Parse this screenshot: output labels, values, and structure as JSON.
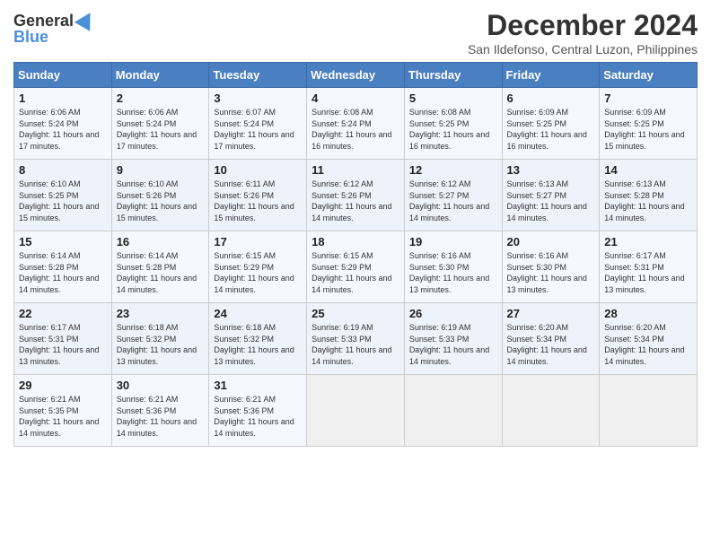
{
  "header": {
    "logo_line1": "General",
    "logo_line2": "Blue",
    "title": "December 2024",
    "subtitle": "San Ildefonso, Central Luzon, Philippines"
  },
  "days_of_week": [
    "Sunday",
    "Monday",
    "Tuesday",
    "Wednesday",
    "Thursday",
    "Friday",
    "Saturday"
  ],
  "weeks": [
    [
      {
        "day": "1",
        "sunrise": "Sunrise: 6:06 AM",
        "sunset": "Sunset: 5:24 PM",
        "daylight": "Daylight: 11 hours and 17 minutes."
      },
      {
        "day": "2",
        "sunrise": "Sunrise: 6:06 AM",
        "sunset": "Sunset: 5:24 PM",
        "daylight": "Daylight: 11 hours and 17 minutes."
      },
      {
        "day": "3",
        "sunrise": "Sunrise: 6:07 AM",
        "sunset": "Sunset: 5:24 PM",
        "daylight": "Daylight: 11 hours and 17 minutes."
      },
      {
        "day": "4",
        "sunrise": "Sunrise: 6:08 AM",
        "sunset": "Sunset: 5:24 PM",
        "daylight": "Daylight: 11 hours and 16 minutes."
      },
      {
        "day": "5",
        "sunrise": "Sunrise: 6:08 AM",
        "sunset": "Sunset: 5:25 PM",
        "daylight": "Daylight: 11 hours and 16 minutes."
      },
      {
        "day": "6",
        "sunrise": "Sunrise: 6:09 AM",
        "sunset": "Sunset: 5:25 PM",
        "daylight": "Daylight: 11 hours and 16 minutes."
      },
      {
        "day": "7",
        "sunrise": "Sunrise: 6:09 AM",
        "sunset": "Sunset: 5:25 PM",
        "daylight": "Daylight: 11 hours and 15 minutes."
      }
    ],
    [
      {
        "day": "8",
        "sunrise": "Sunrise: 6:10 AM",
        "sunset": "Sunset: 5:25 PM",
        "daylight": "Daylight: 11 hours and 15 minutes."
      },
      {
        "day": "9",
        "sunrise": "Sunrise: 6:10 AM",
        "sunset": "Sunset: 5:26 PM",
        "daylight": "Daylight: 11 hours and 15 minutes."
      },
      {
        "day": "10",
        "sunrise": "Sunrise: 6:11 AM",
        "sunset": "Sunset: 5:26 PM",
        "daylight": "Daylight: 11 hours and 15 minutes."
      },
      {
        "day": "11",
        "sunrise": "Sunrise: 6:12 AM",
        "sunset": "Sunset: 5:26 PM",
        "daylight": "Daylight: 11 hours and 14 minutes."
      },
      {
        "day": "12",
        "sunrise": "Sunrise: 6:12 AM",
        "sunset": "Sunset: 5:27 PM",
        "daylight": "Daylight: 11 hours and 14 minutes."
      },
      {
        "day": "13",
        "sunrise": "Sunrise: 6:13 AM",
        "sunset": "Sunset: 5:27 PM",
        "daylight": "Daylight: 11 hours and 14 minutes."
      },
      {
        "day": "14",
        "sunrise": "Sunrise: 6:13 AM",
        "sunset": "Sunset: 5:28 PM",
        "daylight": "Daylight: 11 hours and 14 minutes."
      }
    ],
    [
      {
        "day": "15",
        "sunrise": "Sunrise: 6:14 AM",
        "sunset": "Sunset: 5:28 PM",
        "daylight": "Daylight: 11 hours and 14 minutes."
      },
      {
        "day": "16",
        "sunrise": "Sunrise: 6:14 AM",
        "sunset": "Sunset: 5:28 PM",
        "daylight": "Daylight: 11 hours and 14 minutes."
      },
      {
        "day": "17",
        "sunrise": "Sunrise: 6:15 AM",
        "sunset": "Sunset: 5:29 PM",
        "daylight": "Daylight: 11 hours and 14 minutes."
      },
      {
        "day": "18",
        "sunrise": "Sunrise: 6:15 AM",
        "sunset": "Sunset: 5:29 PM",
        "daylight": "Daylight: 11 hours and 14 minutes."
      },
      {
        "day": "19",
        "sunrise": "Sunrise: 6:16 AM",
        "sunset": "Sunset: 5:30 PM",
        "daylight": "Daylight: 11 hours and 13 minutes."
      },
      {
        "day": "20",
        "sunrise": "Sunrise: 6:16 AM",
        "sunset": "Sunset: 5:30 PM",
        "daylight": "Daylight: 11 hours and 13 minutes."
      },
      {
        "day": "21",
        "sunrise": "Sunrise: 6:17 AM",
        "sunset": "Sunset: 5:31 PM",
        "daylight": "Daylight: 11 hours and 13 minutes."
      }
    ],
    [
      {
        "day": "22",
        "sunrise": "Sunrise: 6:17 AM",
        "sunset": "Sunset: 5:31 PM",
        "daylight": "Daylight: 11 hours and 13 minutes."
      },
      {
        "day": "23",
        "sunrise": "Sunrise: 6:18 AM",
        "sunset": "Sunset: 5:32 PM",
        "daylight": "Daylight: 11 hours and 13 minutes."
      },
      {
        "day": "24",
        "sunrise": "Sunrise: 6:18 AM",
        "sunset": "Sunset: 5:32 PM",
        "daylight": "Daylight: 11 hours and 13 minutes."
      },
      {
        "day": "25",
        "sunrise": "Sunrise: 6:19 AM",
        "sunset": "Sunset: 5:33 PM",
        "daylight": "Daylight: 11 hours and 14 minutes."
      },
      {
        "day": "26",
        "sunrise": "Sunrise: 6:19 AM",
        "sunset": "Sunset: 5:33 PM",
        "daylight": "Daylight: 11 hours and 14 minutes."
      },
      {
        "day": "27",
        "sunrise": "Sunrise: 6:20 AM",
        "sunset": "Sunset: 5:34 PM",
        "daylight": "Daylight: 11 hours and 14 minutes."
      },
      {
        "day": "28",
        "sunrise": "Sunrise: 6:20 AM",
        "sunset": "Sunset: 5:34 PM",
        "daylight": "Daylight: 11 hours and 14 minutes."
      }
    ],
    [
      {
        "day": "29",
        "sunrise": "Sunrise: 6:21 AM",
        "sunset": "Sunset: 5:35 PM",
        "daylight": "Daylight: 11 hours and 14 minutes."
      },
      {
        "day": "30",
        "sunrise": "Sunrise: 6:21 AM",
        "sunset": "Sunset: 5:36 PM",
        "daylight": "Daylight: 11 hours and 14 minutes."
      },
      {
        "day": "31",
        "sunrise": "Sunrise: 6:21 AM",
        "sunset": "Sunset: 5:36 PM",
        "daylight": "Daylight: 11 hours and 14 minutes."
      },
      null,
      null,
      null,
      null
    ]
  ]
}
